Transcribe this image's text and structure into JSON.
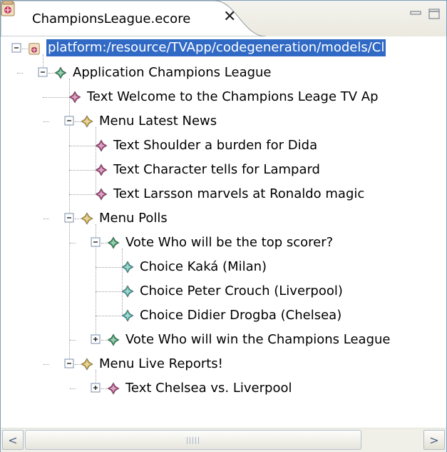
{
  "tab": {
    "title": "ChampionsLeague.ecore",
    "close_glyph": "✕",
    "icon": "ecore-model-icon"
  },
  "window_buttons": {
    "minimize": "minimize-icon",
    "maximize": "maximize-icon"
  },
  "colors": {
    "selection": "#316ac5",
    "ecore_icon": "#b03a5b",
    "text_diamond": "#a8407a",
    "menu_diamond": "#c8a53b",
    "vote_diamond": "#2d8f5a",
    "choice_diamond": "#3fa39a"
  },
  "tree": [
    {
      "label": "platform:/resource/TVApp/codegeneration/models/Cl",
      "icon": "resource-icon",
      "expander": "minus",
      "selected": true
    },
    {
      "label": "Application Champions League",
      "icon": "application-icon",
      "expander": "minus"
    },
    {
      "label": "Text Welcome to the Champions Leage TV Ap",
      "icon": "text-node-icon"
    },
    {
      "label": "Menu Latest News",
      "icon": "menu-node-icon",
      "expander": "minus"
    },
    {
      "label": "Text Shoulder a burden for Dida",
      "icon": "text-node-icon"
    },
    {
      "label": "Text Character tells for Lampard",
      "icon": "text-node-icon"
    },
    {
      "label": "Text Larsson marvels at Ronaldo magic",
      "icon": "text-node-icon"
    },
    {
      "label": "Menu Polls",
      "icon": "menu-node-icon",
      "expander": "minus"
    },
    {
      "label": "Vote Who will be the top scorer?",
      "icon": "vote-node-icon",
      "expander": "minus"
    },
    {
      "label": "Choice Kaká (Milan)",
      "icon": "choice-node-icon"
    },
    {
      "label": "Choice Peter Crouch (Liverpool)",
      "icon": "choice-node-icon"
    },
    {
      "label": "Choice Didier Drogba (Chelsea)",
      "icon": "choice-node-icon"
    },
    {
      "label": "Vote Who will win the Champions League",
      "icon": "vote-node-icon",
      "expander": "plus"
    },
    {
      "label": "Menu Live Reports!",
      "icon": "menu-node-icon",
      "expander": "minus"
    },
    {
      "label": "Text Chelsea vs. Liverpool",
      "icon": "text-node-icon",
      "expander": "plus"
    }
  ],
  "scrollbar": {
    "left_arrow": "<",
    "right_arrow": ">",
    "grip": "scroll-grip-icon"
  }
}
